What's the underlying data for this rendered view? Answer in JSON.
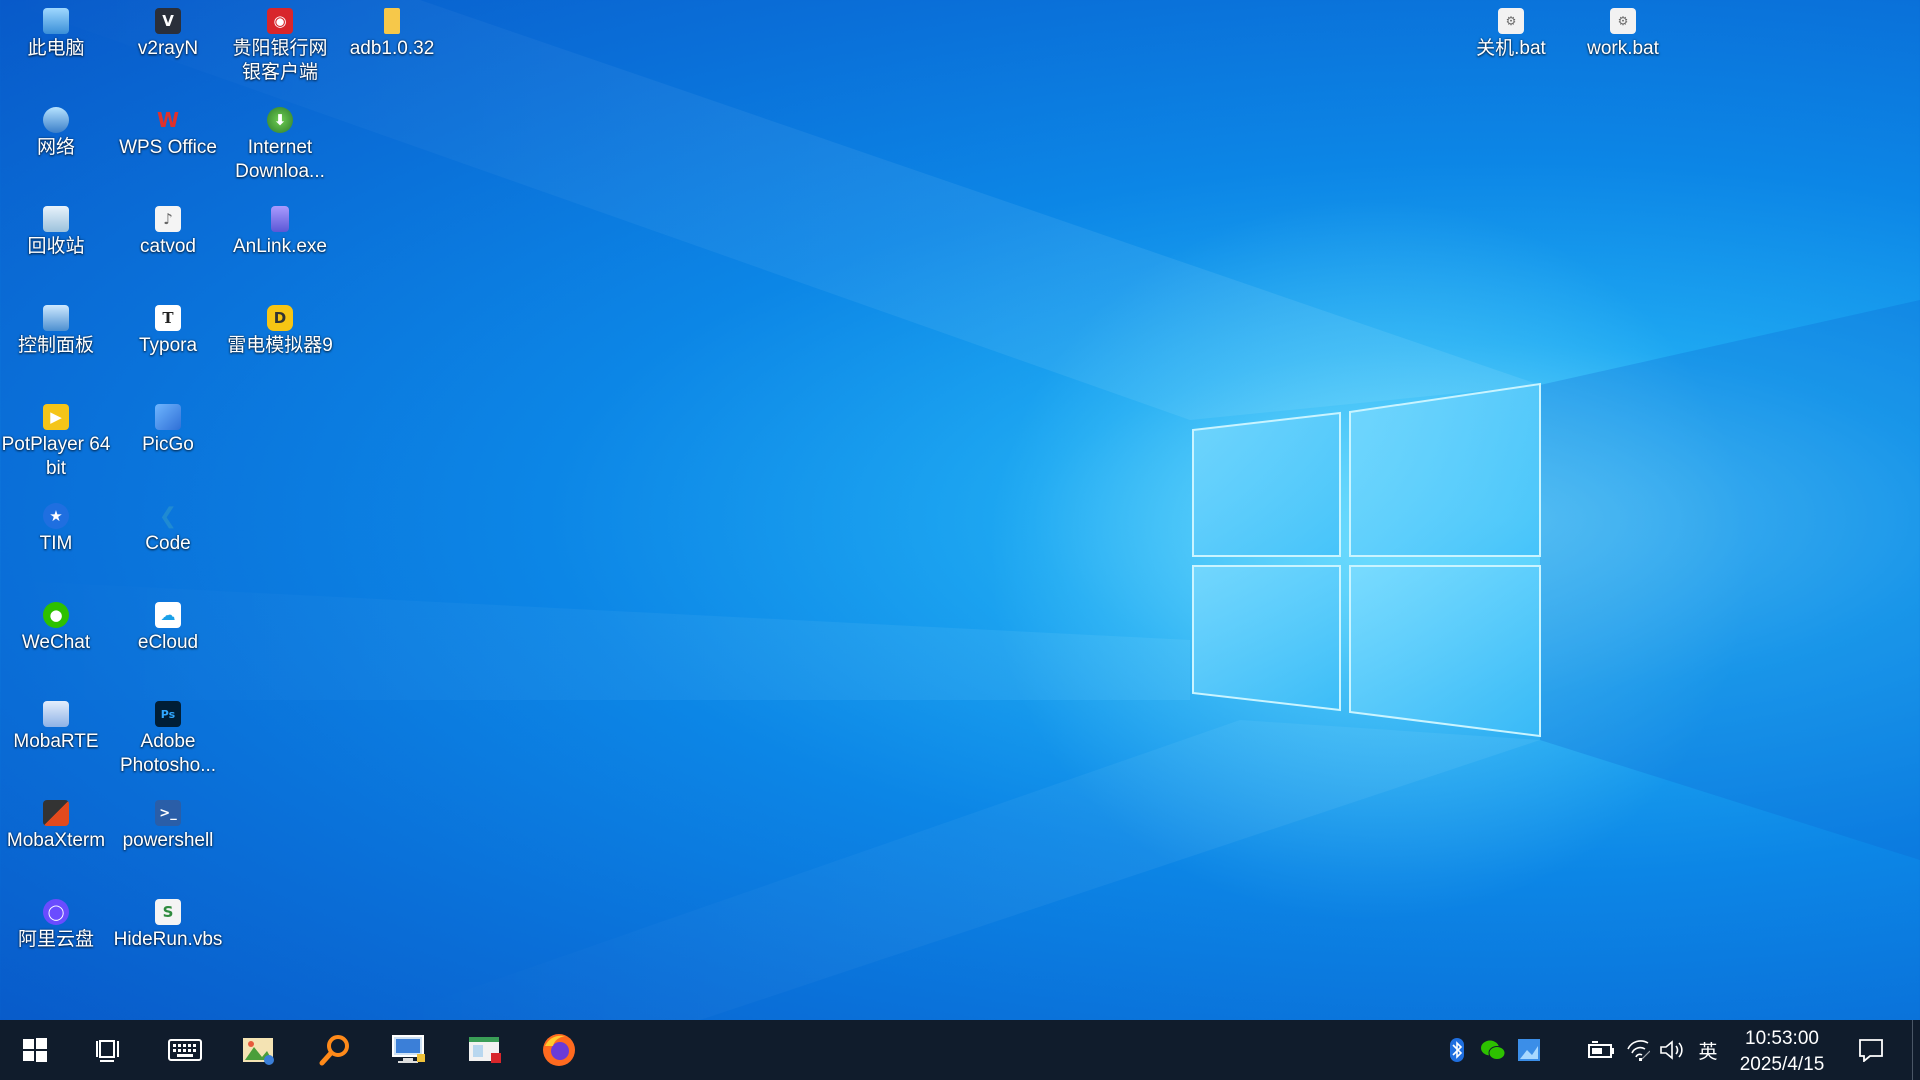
{
  "desktop": {
    "icons": [
      {
        "label": "此电脑",
        "icon": "this-pc-icon"
      },
      {
        "label": "网络",
        "icon": "network-icon"
      },
      {
        "label": "回收站",
        "icon": "recycle-bin-icon"
      },
      {
        "label": "控制面板",
        "icon": "control-panel-icon"
      },
      {
        "label": "PotPlayer 64 bit",
        "icon": "potplayer-icon"
      },
      {
        "label": "TIM",
        "icon": "tim-icon"
      },
      {
        "label": "WeChat",
        "icon": "wechat-icon"
      },
      {
        "label": "MobaRTE",
        "icon": "mobarte-icon"
      },
      {
        "label": "MobaXterm",
        "icon": "mobaxterm-icon"
      },
      {
        "label": "阿里云盘",
        "icon": "aliyun-drive-icon"
      },
      {
        "label": "v2rayN",
        "icon": "v2rayn-icon"
      },
      {
        "label": "WPS Office",
        "icon": "wps-icon"
      },
      {
        "label": "catvod",
        "icon": "catvod-icon"
      },
      {
        "label": "Typora",
        "icon": "typora-icon"
      },
      {
        "label": "PicGo",
        "icon": "picgo-icon"
      },
      {
        "label": "Code",
        "icon": "vscode-icon"
      },
      {
        "label": "eCloud",
        "icon": "ecloud-icon"
      },
      {
        "label": "Adobe Photosho...",
        "icon": "photoshop-icon"
      },
      {
        "label": "powershell",
        "icon": "powershell-icon"
      },
      {
        "label": "HideRun.vbs",
        "icon": "vbs-script-icon"
      },
      {
        "label": "贵阳银行网银客户端",
        "icon": "bank-client-icon"
      },
      {
        "label": "Internet Downloa...",
        "icon": "idm-icon"
      },
      {
        "label": "AnLink.exe",
        "icon": "anlink-icon"
      },
      {
        "label": "雷电模拟器9",
        "icon": "ldplayer-icon"
      },
      {
        "label": "adb1.0.32",
        "icon": "folder-icon"
      },
      {
        "label": "关机.bat",
        "icon": "bat-file-icon"
      },
      {
        "label": "work.bat",
        "icon": "bat-file-icon"
      }
    ]
  },
  "taskbar": {
    "apps": [
      {
        "icon": "windows-start-icon"
      },
      {
        "icon": "task-view-icon"
      },
      {
        "icon": "keyboard-icon"
      },
      {
        "icon": "image-viewer-icon"
      },
      {
        "icon": "search-magnifier-icon"
      },
      {
        "icon": "remote-desktop-icon"
      },
      {
        "icon": "window-app-icon"
      },
      {
        "icon": "firefox-icon"
      }
    ],
    "tray": {
      "ime_label": "英",
      "time": "10:53:00",
      "date": "2025/4/15"
    }
  }
}
